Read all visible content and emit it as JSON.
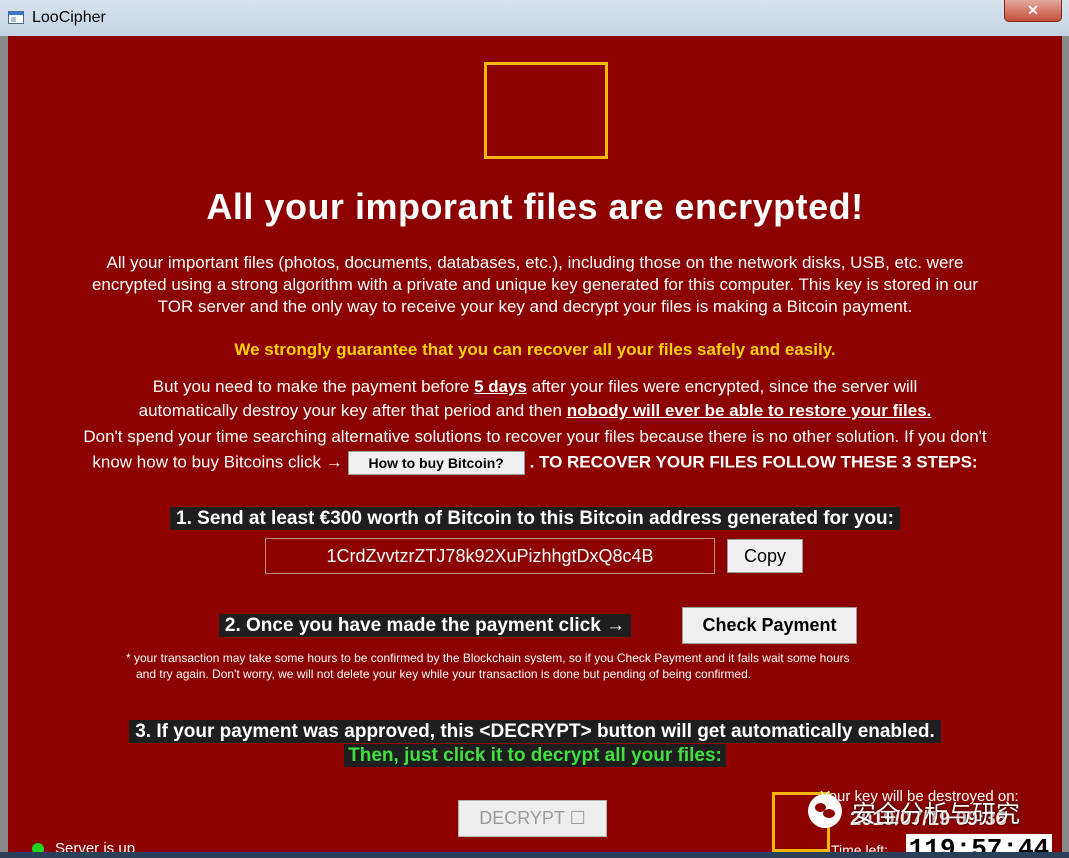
{
  "window": {
    "title": "LooCipher",
    "close_glyph": "✕"
  },
  "headline": "All your imporant files are encrypted!",
  "intro": {
    "line1": "All your important files (photos, documents, databases, etc.), including those on the network disks, USB, etc. were",
    "line2": "encrypted using a strong algorithm with a private and unique key generated for this computer. This key is stored in our",
    "line3": "TOR server and the only way to receive your key and decrypt your files is making a Bitcoin payment."
  },
  "guarantee": "We strongly guarantee that you can recover all your files safely and easily.",
  "deadline": {
    "pre": "But you need to make the payment before",
    "days": "5 days",
    "post": "after your files were encrypted, since the server will",
    "line2_pre": "automatically destroy your key after that period and then",
    "line2_emph": "nobody will ever be able to restore your files."
  },
  "advice": {
    "line1": "Don't spend your time searching alternative solutions to recover your files because there is no other solution. If you don't",
    "line2_pre": "know how to buy Bitcoins click →",
    "howto_button": "How to buy Bitcoin?",
    "line2_post": ". TO RECOVER YOUR FILES FOLLOW THESE 3 STEPS:"
  },
  "step1": {
    "text": "1. Send at least €300 worth of Bitcoin to this Bitcoin address generated for you:",
    "address": "1CrdZvvtzrZTJ78k92XuPizhhgtDxQ8c4B",
    "copy_button": "Copy"
  },
  "step2": {
    "text": "2. Once you have made the payment click →",
    "check_button": "Check Payment",
    "note_line1": "* your transaction may take some hours to be confirmed by the Blockchain system, so if you Check Payment and it fails wait some hours",
    "note_line2": "and try again. Don't worry, we will not delete your key while your transaction is done but pending of being confirmed."
  },
  "step3": {
    "text": "3. If your payment was approved, this <DECRYPT> button will get automatically enabled.",
    "then": "Then, just click it to decrypt all your files:",
    "decrypt_button": "DECRYPT ☐"
  },
  "countdown": {
    "destroy_label": "Your key will be destroyed on:",
    "destroy_date": "2019/07/19 09:36",
    "time_left_label": "Time left:",
    "time_left": "119:57:44"
  },
  "watermark": "安全分析与研究",
  "server_status": "Server is up",
  "colors": {
    "background": "#8c0000",
    "accent_yellow": "#ffd200",
    "then_green": "#3fe03f",
    "status_green": "#1fd51f"
  }
}
